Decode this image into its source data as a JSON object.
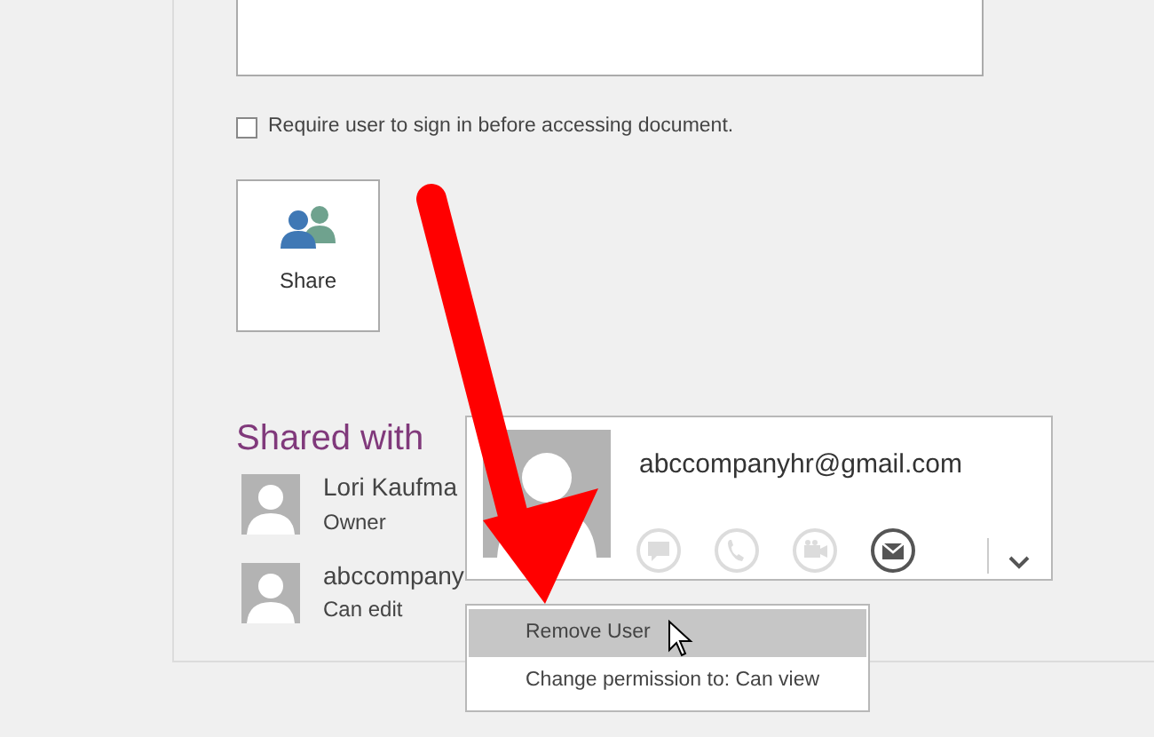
{
  "access": {
    "require_sign_in": {
      "label": "Require user to sign in before accessing document.",
      "checked": false
    }
  },
  "share_button": {
    "label": "Share"
  },
  "shared_with": {
    "title": "Shared with",
    "people": [
      {
        "name": "Lori Kaufma",
        "role": "Owner"
      },
      {
        "name": "abccompany",
        "role": "Can edit"
      }
    ]
  },
  "contact_card": {
    "email": "abccompanyhr@gmail.com",
    "actions": [
      {
        "kind": "chat",
        "disabled": true
      },
      {
        "kind": "call",
        "disabled": true
      },
      {
        "kind": "video",
        "disabled": true
      },
      {
        "kind": "mail",
        "disabled": false
      }
    ]
  },
  "context_menu": {
    "items": [
      {
        "label": "Remove User",
        "selected": true
      },
      {
        "label": "Change permission to: Can view",
        "selected": false
      }
    ]
  }
}
